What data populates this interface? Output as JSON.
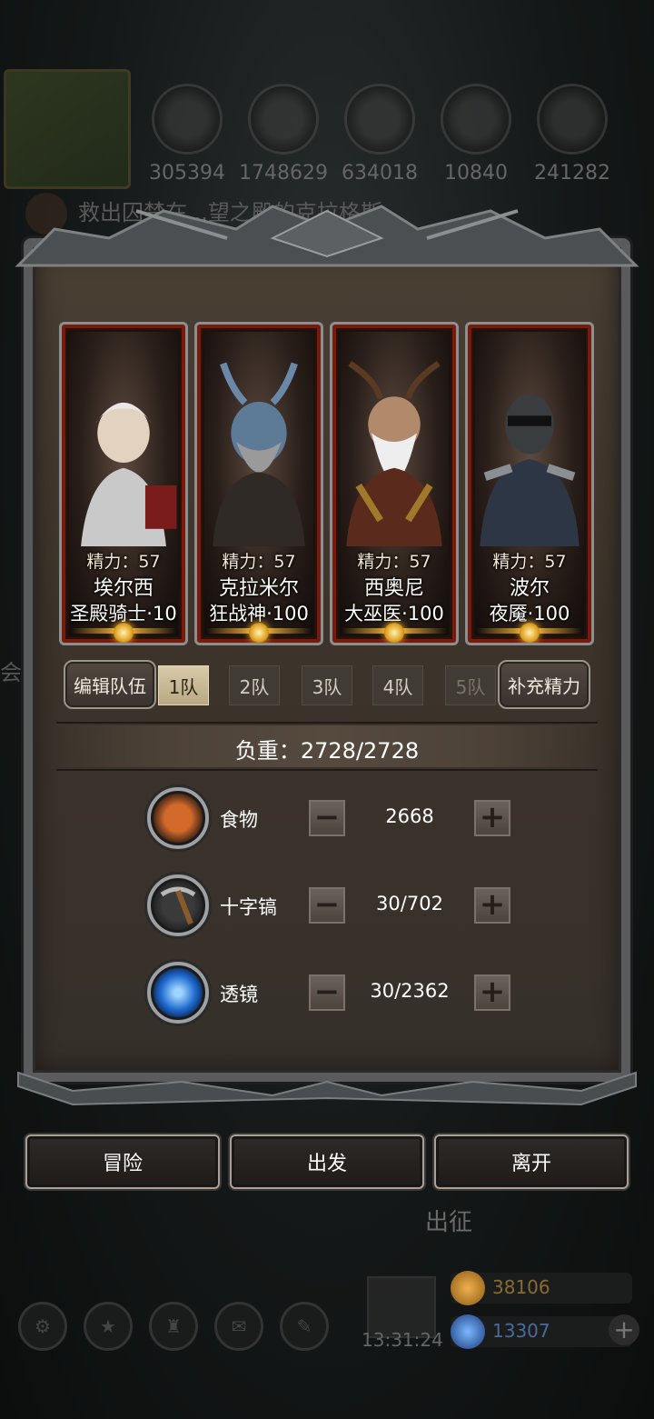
{
  "resources": [
    {
      "icon": "food-icon",
      "amount": "305394",
      "color": "#c0602a"
    },
    {
      "icon": "wood-icon",
      "amount": "1748629",
      "color": "#b58540"
    },
    {
      "icon": "iron-icon",
      "amount": "634018",
      "color": "#8a8a8a"
    },
    {
      "icon": "crystal-icon",
      "amount": "10840",
      "color": "#3a8ac8"
    },
    {
      "icon": "stone-icon",
      "amount": "241282",
      "color": "#777777"
    }
  ],
  "quest": {
    "text": "救出囚禁在...望之殿的克拉格斯..."
  },
  "side_text": "会",
  "heroes": [
    {
      "stamina": "精力：57",
      "name": "埃尔西",
      "class_level": "圣殿骑士·10"
    },
    {
      "stamina": "精力：57",
      "name": "克拉米尔",
      "class_level": "狂战神·100"
    },
    {
      "stamina": "精力：57",
      "name": "西奥尼",
      "class_level": "大巫医·100"
    },
    {
      "stamina": "精力：57",
      "name": "波尔",
      "class_level": "夜魇·100"
    }
  ],
  "team_bar": {
    "edit": "编辑队伍",
    "teams": [
      "1队",
      "2队",
      "3队",
      "4队",
      "5队"
    ],
    "active_team": 0,
    "refill": "补充精力"
  },
  "load": "负重：2728/2728",
  "supplies": [
    {
      "label": "食物",
      "value": "2668",
      "icon": "food-icon"
    },
    {
      "label": "十字镐",
      "value": "30/702",
      "icon": "pickaxe-icon"
    },
    {
      "label": "透镜",
      "value": "30/2362",
      "icon": "lens-icon"
    }
  ],
  "actions": {
    "adventure": "冒险",
    "depart": "出发",
    "leave": "离开"
  },
  "campaign_label": "出征",
  "clock": "13:31:24",
  "currencies": [
    {
      "icon": "gold-icon",
      "amount": "38106",
      "color": "#d08a30"
    },
    {
      "icon": "gem-icon",
      "amount": "13307",
      "color": "#3a7ac8"
    }
  ]
}
